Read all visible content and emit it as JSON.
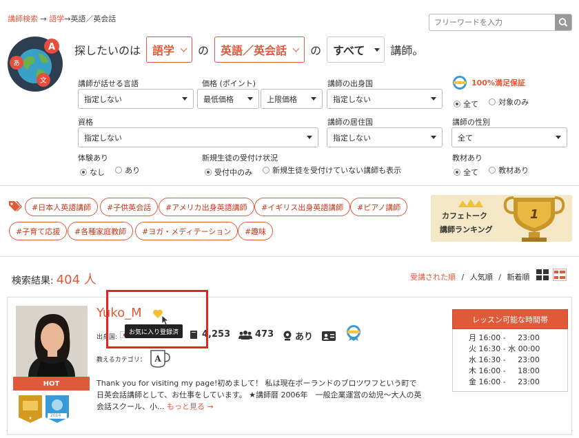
{
  "breadcrumb": {
    "home": "講師検索",
    "arrow1": "→",
    "lang": "語学",
    "arrow2": "→",
    "current": "英語／英会話"
  },
  "search": {
    "placeholder": "フリーワードを入力"
  },
  "headline": {
    "prefix": "探したいのは",
    "cat_value": "語学",
    "no1": "の",
    "sub_value": "英語／英会話",
    "no2": "の",
    "type_value": "すべて",
    "suffix": "講師。"
  },
  "filters": {
    "spoken_lang": {
      "label": "講師が話せる言語",
      "value": "指定しない"
    },
    "price": {
      "label": "価格 (ポイント)",
      "min": "最低価格",
      "max": "上限価格"
    },
    "origin": {
      "label": "講師の出身国",
      "value": "指定しない"
    },
    "guarantee": {
      "label": "100%満足保証",
      "opt_all": "全て",
      "opt_target": "対象のみ"
    },
    "qualification": {
      "label": "資格",
      "value": "指定しない"
    },
    "residence": {
      "label": "講師の居住国",
      "value": "指定しない"
    },
    "gender": {
      "label": "講師の性別",
      "value": "全て"
    },
    "experience": {
      "label": "体験あり",
      "opt_none": "なし",
      "opt_yes": "あり"
    },
    "accepting": {
      "label": "新規生徒の受付け状況",
      "opt_accepting": "受付中のみ",
      "opt_all": "新規生徒を受付けていない講師も表示"
    },
    "materials": {
      "label": "教材あり",
      "opt_all": "全て",
      "opt_materials": "教材あり"
    }
  },
  "tags": [
    "#日本人英語講師",
    "#子供英会話",
    "#アメリカ出身英語講師",
    "#イギリス出身英語講師",
    "#ピアノ講師",
    "#子育て応援",
    "#各種家庭教師",
    "#ヨガ・メディテーション",
    "#趣味"
  ],
  "banner": {
    "line1": "カフェトーク",
    "line2": "講師ランキング",
    "rank": "1"
  },
  "results": {
    "label": "検索結果:",
    "count": "404 人"
  },
  "sort": {
    "opt1": "受講された順",
    "sep": "/",
    "opt2": "人気順",
    "opt3": "新着順"
  },
  "tutor": {
    "name": "Yuko_M",
    "tooltip": "お気に入り登録済",
    "origin_label": "出身国:",
    "lessons": "4,253",
    "students": "473",
    "trial": "あり",
    "category_label": "教えるカテゴリ：",
    "hot": "HOT",
    "badge_year": "2014",
    "description": "Thank you for visiting my page!初めまして！ 私は現在ポーランドのブロツワフという町で日英会話講師として、お仕事をしています。 ★講師暦 2006年　一般企業運営の幼児〜大人の英会話スクール、小...",
    "more": "もっと見る →"
  },
  "schedule": {
    "title": "レッスン可能な時間帯",
    "rows": [
      "月 16:00 -     23:00",
      "火 16:30 - 水 00:00",
      "水 16:30 -     23:00",
      "木 16:00 -     18:00",
      "金 16:00 -     23:00"
    ]
  },
  "colors": {
    "accent": "#e05a3a",
    "highlight_box": "#e6231e"
  }
}
